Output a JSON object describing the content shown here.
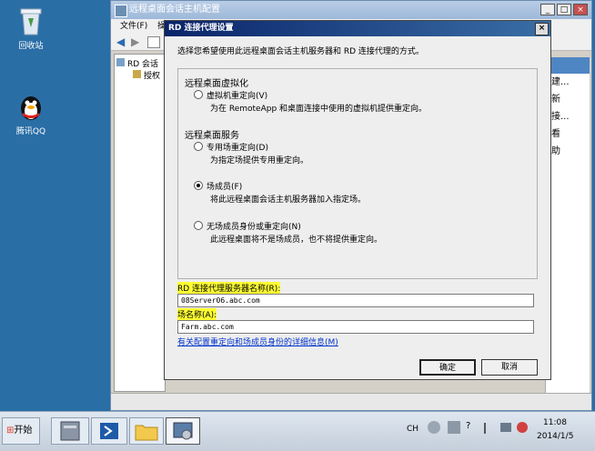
{
  "desktop": {
    "recycle_label": "回收站",
    "qq_label": "腾讯QQ"
  },
  "main_window": {
    "title": "远程桌面会话主机配置",
    "menu_file": "文件(F)",
    "menu_action": "操",
    "tree_root": "RD 会话",
    "tree_child": "授权",
    "right_items": [
      "建...",
      "新",
      "接...",
      "看",
      "助"
    ]
  },
  "dialog": {
    "title": "RD 连接代理设置",
    "intro": "选择您希望使用此远程桌面会话主机服务器和 RD 连接代理的方式。",
    "group1_title": "远程桌面虚拟化",
    "opt_vm": "虚拟机重定向(V)",
    "opt_vm_desc": "为在 RemoteApp 和桌面连接中使用的虚拟机提供重定向。",
    "group2_title": "远程桌面服务",
    "opt_dedicated": "专用场重定向(D)",
    "opt_dedicated_desc": "为指定场提供专用重定向。",
    "opt_farm": "场成员(F)",
    "opt_farm_desc": "将此远程桌面会话主机服务器加入指定场。",
    "opt_none": "无场成员身份或重定向(N)",
    "opt_none_desc": "此远程桌面将不是场成员，也不将提供重定向。",
    "server_label": "RD 连接代理服务器名称(R):",
    "server_value": "08Server06.abc.com",
    "farm_label": "场名称(A):",
    "farm_value": "Farm.abc.com",
    "more_link": "有关配置重定向和场成员身份的详细信息(M)",
    "ok": "确定",
    "cancel": "取消"
  },
  "taskbar": {
    "start": "开始",
    "lang": "CH",
    "time": "11:08",
    "date": "2014/1/5"
  }
}
